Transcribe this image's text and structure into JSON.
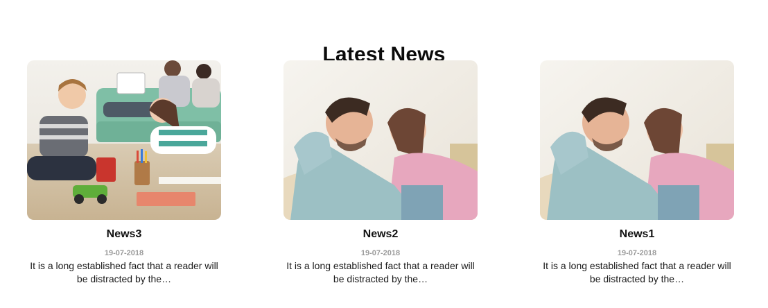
{
  "section": {
    "title": "Latest News"
  },
  "news": [
    {
      "title": "News3",
      "date": "19-07-2018",
      "excerpt": "It is a long established fact that a reader will be distracted by the…",
      "image": "kids-playing-family-photo"
    },
    {
      "title": "News2",
      "date": "19-07-2018",
      "excerpt": "It is a long established fact that a reader will be distracted by the…",
      "image": "couple-relaxing-sofa-photo"
    },
    {
      "title": "News1",
      "date": "19-07-2018",
      "excerpt": "It is a long established fact that a reader will be distracted by the…",
      "image": "couple-relaxing-sofa-photo"
    }
  ]
}
